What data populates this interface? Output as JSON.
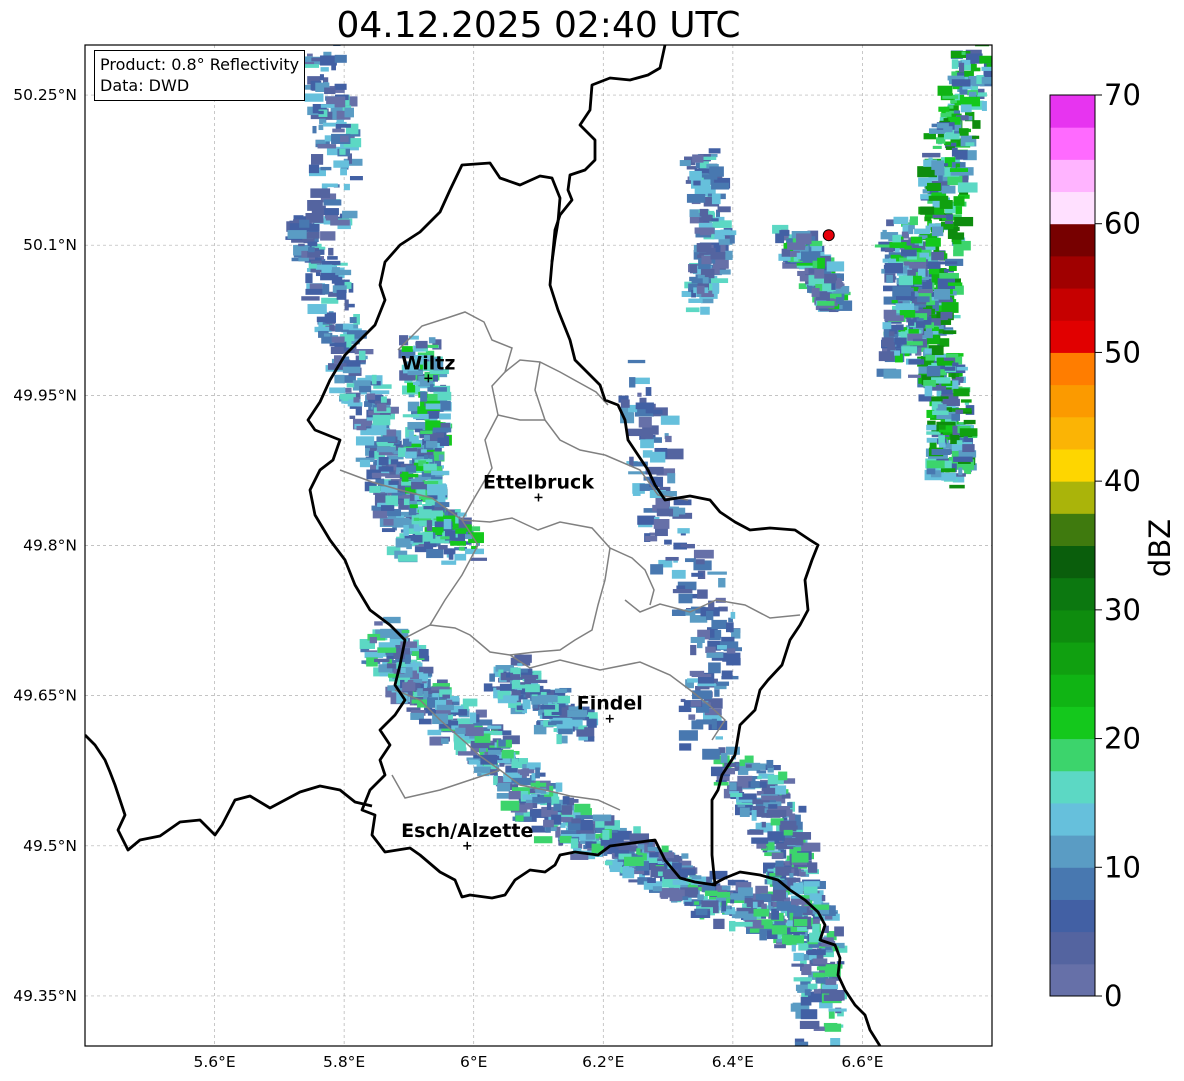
{
  "title": "04.12.2025 02:40 UTC",
  "info_box": {
    "product": "Product: 0.8° Reflectivity",
    "data": "Data: DWD"
  },
  "map": {
    "lon_range": [
      5.4,
      6.8
    ],
    "lat_range": [
      49.3,
      50.3
    ],
    "x_ticks": [
      {
        "value": 5.6,
        "label": "5.6°E"
      },
      {
        "value": 5.8,
        "label": "5.8°E"
      },
      {
        "value": 6.0,
        "label": "6°E"
      },
      {
        "value": 6.2,
        "label": "6.2°E"
      },
      {
        "value": 6.4,
        "label": "6.4°E"
      },
      {
        "value": 6.6,
        "label": "6.6°E"
      }
    ],
    "y_ticks": [
      {
        "value": 50.25,
        "label": "50.25°N"
      },
      {
        "value": 50.1,
        "label": "50.1°N"
      },
      {
        "value": 49.95,
        "label": "49.95°N"
      },
      {
        "value": 49.8,
        "label": "49.8°N"
      },
      {
        "value": 49.65,
        "label": "49.65°N"
      },
      {
        "value": 49.5,
        "label": "49.5°N"
      },
      {
        "value": 49.35,
        "label": "49.35°N"
      }
    ],
    "cities": [
      {
        "name": "Wiltz",
        "lon": 5.93,
        "lat": 49.967
      },
      {
        "name": "Ettelbruck",
        "lon": 6.1,
        "lat": 49.848
      },
      {
        "name": "Findel",
        "lon": 6.21,
        "lat": 49.627
      },
      {
        "name": "Esch/Alzette",
        "lon": 5.99,
        "lat": 49.5
      }
    ],
    "radar_site": {
      "lon": 6.548,
      "lat": 50.11,
      "color": "#e8000b"
    },
    "grid": true
  },
  "colorbar": {
    "label": "dBZ",
    "min": 0,
    "max": 70,
    "step": 2.5,
    "ticks": [
      "0",
      "10",
      "20",
      "30",
      "40",
      "50",
      "60",
      "70"
    ],
    "colors": [
      "#6670a8",
      "#5464a0",
      "#4260a4",
      "#4878b0",
      "#5a9cc4",
      "#66c0dc",
      "#5cd8c4",
      "#3cd46c",
      "#14c81c",
      "#10b414",
      "#10a010",
      "#0e8c0e",
      "#0c7810",
      "#0a5e0c",
      "#3f7a0e",
      "#aab40a",
      "#fed600",
      "#fbb405",
      "#fb9a00",
      "#ff7d00",
      "#e10000",
      "#c60000",
      "#a00000",
      "#770000",
      "#ffe0ff",
      "#ffb4ff",
      "#ff6aff",
      "#e734f0"
    ]
  }
}
